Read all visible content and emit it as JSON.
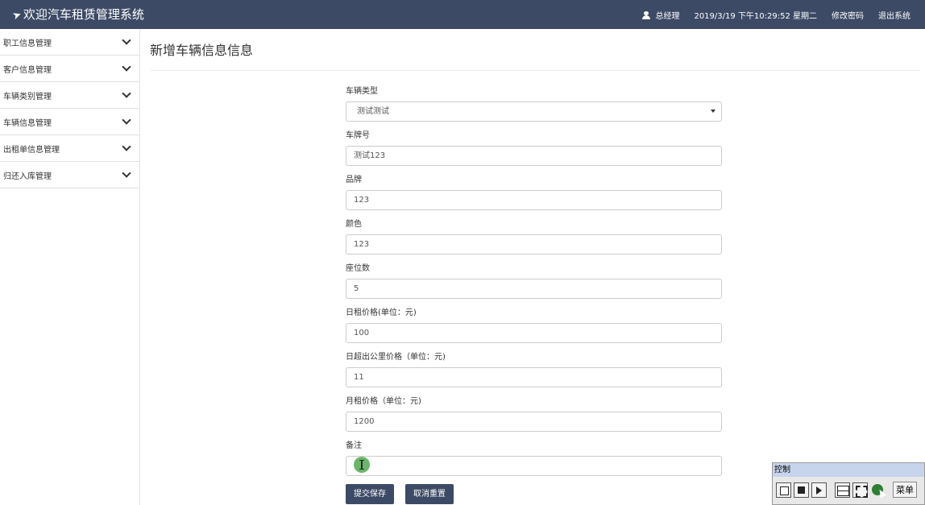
{
  "header": {
    "brand": "欢迎汽车租赁管理系统",
    "user": "总经理",
    "datetime": "2019/3/19 下午10:29:52 星期二",
    "change_password": "修改密码",
    "logout": "退出系统",
    "accent_color": "#3d4a66"
  },
  "sidebar": {
    "items": [
      {
        "label": "职工信息管理",
        "icon": "chevron-down-icon"
      },
      {
        "label": "客户信息管理",
        "icon": "chevron-down-icon"
      },
      {
        "label": "车辆类别管理",
        "icon": "chevron-down-icon"
      },
      {
        "label": "车辆信息管理",
        "icon": "chevron-down-icon"
      },
      {
        "label": "出租单信息管理",
        "icon": "chevron-down-icon"
      },
      {
        "label": "归还入库管理",
        "icon": "chevron-down-icon"
      }
    ]
  },
  "main": {
    "title": "新增车辆信息信息",
    "form": {
      "category": {
        "label": "车辆类型",
        "value": "测试测试"
      },
      "plate": {
        "label": "车牌号",
        "value": "测试123"
      },
      "brand": {
        "label": "品牌",
        "value": "123"
      },
      "color": {
        "label": "颜色",
        "value": "123"
      },
      "seats": {
        "label": "座位数",
        "value": "5"
      },
      "daily_price": {
        "label": "日租价格(单位：元)",
        "value": "100"
      },
      "extra_km_price": {
        "label": "日超出公里价格（单位：元)",
        "value": "11"
      },
      "monthly_price": {
        "label": "月租价格（单位：元)",
        "value": "1200"
      },
      "remark": {
        "label": "备注",
        "value": ""
      }
    },
    "buttons": {
      "submit": "提交保存",
      "reset": "取消重置"
    }
  },
  "control_panel": {
    "title": "控制",
    "menu_label": "菜单"
  }
}
